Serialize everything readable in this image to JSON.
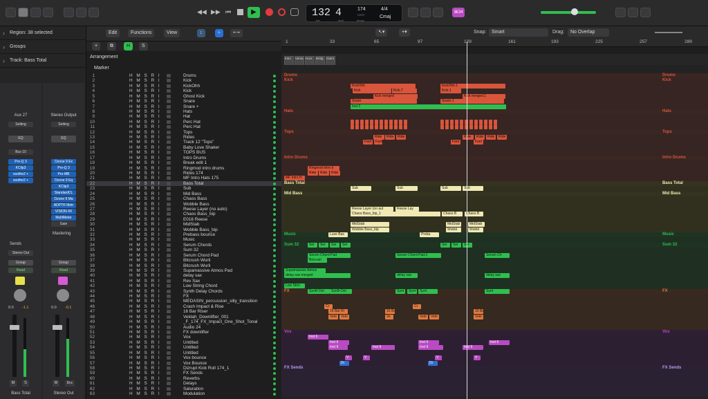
{
  "transport": {
    "bars": "132",
    "beats": "4",
    "bar_lbl": "bar",
    "beat_lbl": "beat",
    "tempo": "174",
    "keep_lbl": "KEEP",
    "tempo_lbl": "tempo",
    "sig": "4/4",
    "key": "Cmaj",
    "badge": "⌘34"
  },
  "inspector": {
    "region": "Region:",
    "region_val": "38 selected",
    "groups": "Groups",
    "track": "Track:",
    "track_val": "Bass Total"
  },
  "strip_left": {
    "name": "Aux 27",
    "setting": "Setting",
    "eq": "EQ",
    "bus": "Bus 10",
    "plugins": [
      "Pro-Q 3",
      "KClip3",
      "soothe2 +",
      "soothe2 +"
    ],
    "sends": "Sends",
    "out": "Stereo Out",
    "group": "Group",
    "read": "Read",
    "vol": "0.0",
    "pan": "-1.1",
    "label": "Bass Total",
    "m": "M",
    "s": "S"
  },
  "strip_right": {
    "name": "Stereo Output",
    "setting": "Setting",
    "eq": "EQ",
    "plugins": [
      "Ozone 9 Ex",
      "Pro-Q 3",
      "Pro-MB",
      "Ozone 9 Eq",
      "KClip3",
      "StandardCL",
      "Ozone 9 Ma",
      "ADPTR Metr",
      "VISION 4X",
      "MultiMeter",
      "Gain"
    ],
    "mastering": "Mastering",
    "group": "Group",
    "read": "Read",
    "vol": "0.0",
    "pan": "-0.1",
    "label": "Stereo Out",
    "m": "M",
    "bnc": "Bnc"
  },
  "trackheader": {
    "edit": "Edit",
    "functions": "Functions",
    "view": "View",
    "h": "H",
    "s": "S",
    "arrangement": "Arrangement",
    "marker": "Marker"
  },
  "snap": {
    "label": "Snap:",
    "value": "Smart",
    "drag": "Drag:",
    "drag_val": "No Overlap"
  },
  "ruler": [
    "1",
    "33",
    "65",
    "97",
    "129",
    "161",
    "193",
    "225",
    "257",
    "289"
  ],
  "arrangement_markers": [
    "Intro",
    "Versa",
    "Hors",
    "Bridg",
    "Outro"
  ],
  "tracks": [
    "Drums",
    "Kick",
    "KickOhh",
    "Kick",
    "Ghost Kick",
    "Snare",
    "Snare +",
    "Hats",
    "Hat",
    "Perc Hat",
    "Perc Hat",
    "Tops",
    "Rides",
    "Track 12 \"Tops\"",
    "Baby Love Shaker",
    "TOPS BUS",
    "Intro Drums",
    "Break edit 1",
    "Ringmod intro drums",
    "Rides 174",
    "MF Intro Hats 175",
    "Bass Total",
    "Sub",
    "Mid Bass",
    "Chaos Bass",
    "Wobble Bass",
    "Reese Layer (no auto)",
    "Chaos Bass_bip",
    "E016 Reese",
    "MidStab",
    "Wobble Bass_bip",
    "Prebass bounce",
    "Music",
    "Serum Chords",
    "Sum 32",
    "Serum Chord Pad",
    "Bitcrush Wurli",
    "Bitcrush Wurli",
    "Supamassive Atmos Pad",
    "delay sax",
    "Rev Sax",
    "Low String Chord",
    "Synth Delay Chords",
    "FX",
    "MEDASIN_percussion_silly_transition",
    "Crash Impact & Rise",
    "16 Bar Riser",
    "Vektah_Downlifter_001",
    "_F_174_FX_Impact_One_Shot_Tonal",
    "Audio 24",
    "FX downlifter",
    "Vox",
    "Untitled",
    "Untitled",
    "Untitled",
    "Vox bounce",
    "Vox Bounce",
    "Dizrupt Kick Roll 174_1",
    "FX Sends",
    "Reverbs",
    "Delays",
    "Saturation",
    "Modulation"
  ],
  "lane_labels": {
    "drums": "Drums",
    "kick": "Kick",
    "hats": "Hats",
    "tops": "Tops",
    "intro": "Intro Drums",
    "bass": "Bass Total",
    "mid": "Mid Bass",
    "music": "Music",
    "sum": "Sum 32",
    "fx": "FX",
    "vox": "Vox",
    "fxsends": "FX Sends"
  },
  "regions": {
    "kickohh": "KickOhh",
    "kickohh1": "KickOhh.1",
    "kick": "Kick",
    "kick7": "Kick.7",
    "kick1": "Kick.1",
    "kickm": "Kick merged",
    "kickm1": "Kick merged.1",
    "snare": "Snare",
    "snare1": "Snare.1",
    "inst2": "Inst 2",
    "ride": "Ride",
    "fant": "Fant",
    "ringmod": "Ringmod intro d",
    "mfintro": "MF Intro H",
    "sub": "Sub",
    "reese": "Reese Layer (no aut",
    "reese2": "Reese Lay",
    "chaos": "Chaos Bass_bip_1",
    "chaosb": "Chaos B",
    "midstab": "MidStab",
    "wobble": "Wobble Bass_bip",
    "wobbl": "Wobbl",
    "luxe": "Luxe Bas",
    "preba": "Preba",
    "ser": "Ser",
    "serum": "Serum Chord Pad",
    "serum3": "Serum Chord Pad.3",
    "serumch": "Serum Ch",
    "bitcrush": "Bitcrush",
    "supa": "Supamassive Atmos",
    "delaym": "delay sax merged",
    "delay": "delay sax",
    "lowstr": "Low Strin",
    "synthdel": "Synth Del",
    "synth": "Synt",
    "crash": "Cr",
    "riser": "16 Bar Ri",
    "vekt": "Vekt",
    "ve": "Ve",
    "inst6": "Inst 6",
    "inst9": "Inst 9",
    "v": "V",
    "di": "Di"
  },
  "colors": {
    "red": "#d9553b",
    "yellow": "#f0e9b4",
    "green": "#2fbf4f",
    "orange": "#e0793f",
    "purple": "#b84bc2",
    "blue": "#2f6fcf",
    "accent": "#2a6fd6"
  }
}
